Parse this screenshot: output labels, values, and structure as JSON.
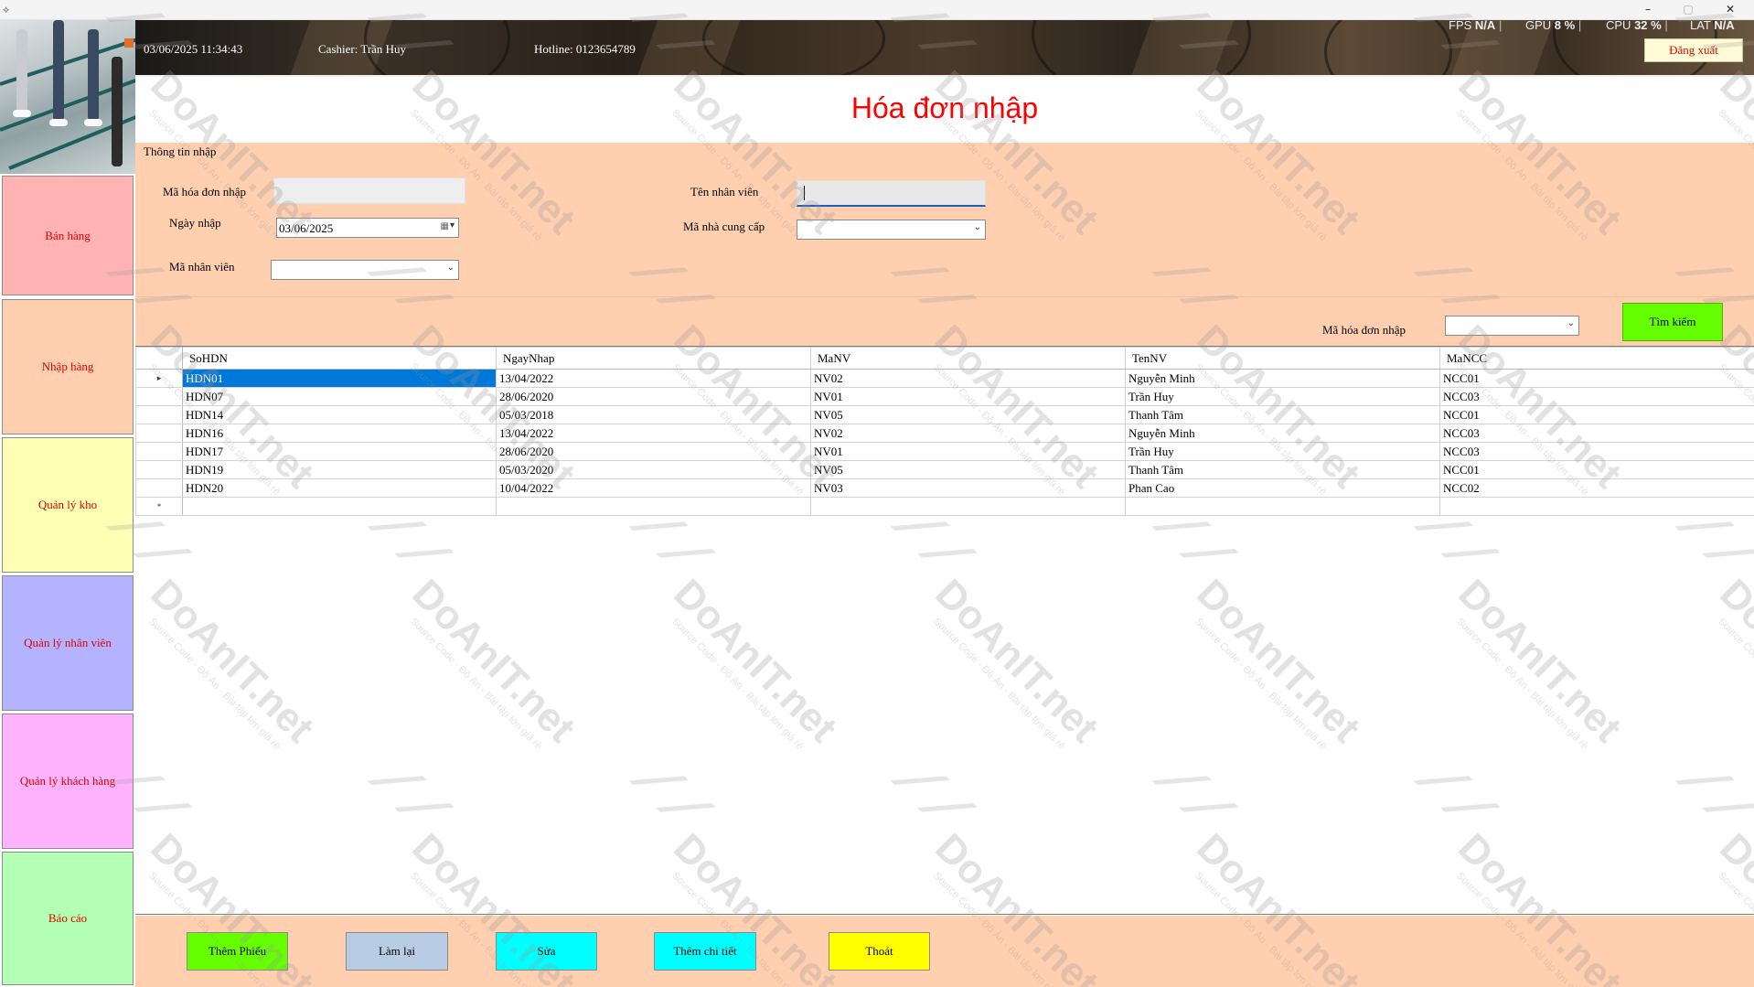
{
  "window": {
    "icon": "app-icon",
    "controls": [
      "minimize-icon",
      "maximize-icon",
      "close-icon"
    ],
    "minimize_glyph": "–",
    "maximize_glyph": "▢",
    "close_glyph": "✕"
  },
  "header": {
    "datetime": "03/06/2025 11:34:43",
    "cashier": "Cashier: Trần Huy",
    "hotline": "Hotline: 0123654789",
    "logout_label": "Đăng xuất",
    "perf": [
      {
        "label": "FPS",
        "value": "N/A"
      },
      {
        "label": "GPU",
        "value": "8 %"
      },
      {
        "label": "CPU",
        "value": "32 %"
      },
      {
        "label": "LAT",
        "value": "N/A"
      }
    ]
  },
  "nav": [
    {
      "label": "Bán hàng",
      "color": "#ffb3b3"
    },
    {
      "label": "Nhập hàng",
      "color": "#ffcfb0"
    },
    {
      "label": "Quản lý kho",
      "color": "#ffffb3"
    },
    {
      "label": "Quản lý nhân viên",
      "color": "#b3b3ff"
    },
    {
      "label": "Quản lý khách hàng",
      "color": "#ffb3ff"
    },
    {
      "label": "Báo cáo",
      "color": "#b3ffb3"
    }
  ],
  "page_title": "Hóa đơn nhập",
  "form": {
    "group_label": "Thông tin nhập",
    "ma_hoa_don_label": "Mã hóa đơn nhập",
    "ma_hoa_don_value": "",
    "ngay_nhap_label": "Ngày nhập",
    "ngay_nhap_value": "03/06/2025",
    "ma_nhan_vien_label": "Mã nhân viên",
    "ma_nhan_vien_value": "",
    "ten_nhan_vien_label": "Tên nhân viên",
    "ten_nhan_vien_value": "",
    "ma_ncc_label": "Mã nhà cung cấp",
    "ma_ncc_value": ""
  },
  "search": {
    "label": "Mã hóa đơn nhập",
    "value": "",
    "button_label": "Tìm kiếm"
  },
  "grid": {
    "columns": [
      "SoHDN",
      "NgayNhap",
      "MaNV",
      "TenNV",
      "MaNCC"
    ],
    "rows": [
      [
        "HDN01",
        "13/04/2022",
        "NV02",
        "Nguyễn Minh",
        "NCC01"
      ],
      [
        "HDN07",
        "28/06/2020",
        "NV01",
        "Trần Huy",
        "NCC03"
      ],
      [
        "HDN14",
        "05/03/2018",
        "NV05",
        "Thanh Tâm",
        "NCC01"
      ],
      [
        "HDN16",
        "13/04/2022",
        "NV02",
        "Nguyễn Minh",
        "NCC03"
      ],
      [
        "HDN17",
        "28/06/2020",
        "NV01",
        "Trần Huy",
        "NCC03"
      ],
      [
        "HDN19",
        "05/03/2020",
        "NV05",
        "Thanh Tâm",
        "NCC01"
      ],
      [
        "HDN20",
        "10/04/2022",
        "NV03",
        "Phan Cao",
        "NCC02"
      ]
    ],
    "current_row_marker": "▸",
    "new_row_marker": "*"
  },
  "actions": [
    {
      "label": "Thêm Phiếu",
      "color": "#66ff00"
    },
    {
      "label": "Làm lại",
      "color": "#b8cde4"
    },
    {
      "label": "Sửa",
      "color": "#00ffff"
    },
    {
      "label": "Thêm chi tiết",
      "color": "#00ffff"
    },
    {
      "label": "Thoát",
      "color": "#ffff00"
    }
  ],
  "watermark": {
    "brand": "DoAnIT.net",
    "tagline": "Source Code - Đồ Án - Bài tập lớn giá rẻ"
  }
}
